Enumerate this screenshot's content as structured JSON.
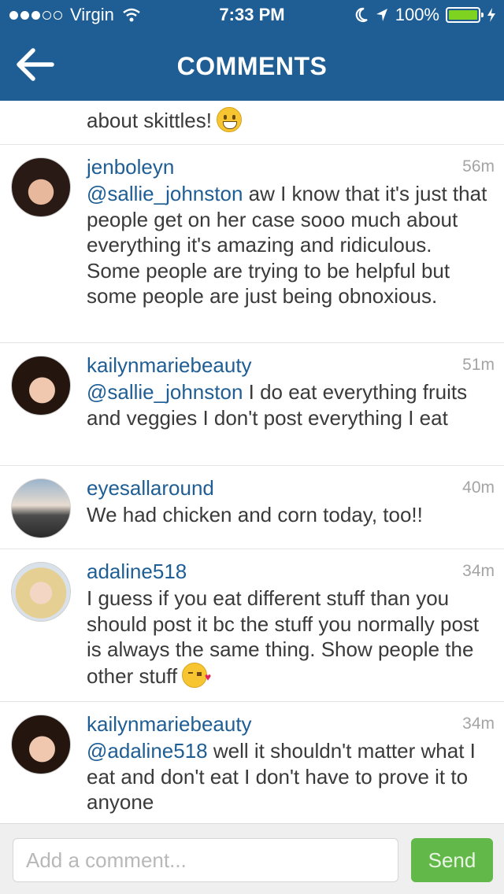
{
  "status_bar": {
    "carrier": "Virgin",
    "time": "7:33 PM",
    "battery": "100%"
  },
  "nav": {
    "title": "COMMENTS"
  },
  "partial_comment": {
    "text": "about skittles!"
  },
  "comments": [
    {
      "username": "jenboleyn",
      "time": "56m",
      "mention": "@sallie_johnston",
      "text": " aw I know that it's just that people get on her case sooo much about everything it's amazing and ridiculous.  Some people are trying to be helpful but some people are just being obnoxious."
    },
    {
      "username": "kailynmariebeauty",
      "time": "51m",
      "mention": "@sallie_johnston",
      "text": " I do eat everything fruits and veggies I don't post everything I eat"
    },
    {
      "username": "eyesallaround",
      "time": "40m",
      "mention": "",
      "text": "We had chicken and corn today, too!!"
    },
    {
      "username": "adaline518",
      "time": "34m",
      "mention": "",
      "text": "I guess if you eat different stuff than you should post it bc the stuff you normally post is always the same thing. Show people the other stuff"
    },
    {
      "username": "kailynmariebeauty",
      "time": "34m",
      "mention": "@adaline518",
      "text": " well it shouldn't matter what I eat and don't eat I don't have to prove it to anyone"
    }
  ],
  "footer": {
    "input_placeholder": "Add a comment...",
    "send_label": "Send"
  },
  "colors": {
    "header": "#1f5e94",
    "link": "#1f5e94",
    "send_button": "#62b849",
    "battery": "#7ed321"
  }
}
